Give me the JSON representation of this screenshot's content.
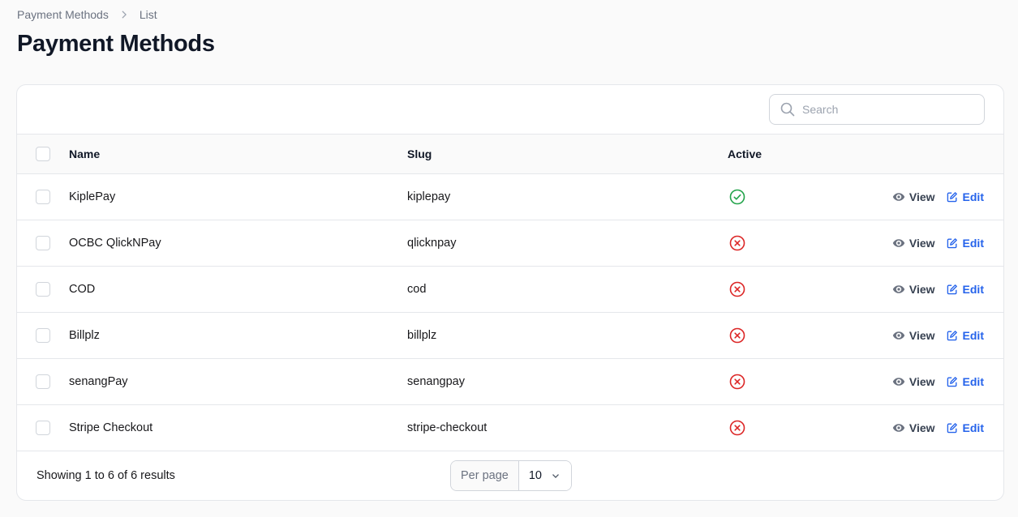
{
  "breadcrumb": {
    "parent": "Payment Methods",
    "current": "List"
  },
  "page": {
    "title": "Payment Methods"
  },
  "search": {
    "placeholder": "Search"
  },
  "table": {
    "headers": {
      "name": "Name",
      "slug": "Slug",
      "active": "Active"
    },
    "rows": [
      {
        "name": "KiplePay",
        "slug": "kiplepay",
        "active": true
      },
      {
        "name": "OCBC QlickNPay",
        "slug": "qlicknpay",
        "active": false
      },
      {
        "name": "COD",
        "slug": "cod",
        "active": false
      },
      {
        "name": "Billplz",
        "slug": "billplz",
        "active": false
      },
      {
        "name": "senangPay",
        "slug": "senangpay",
        "active": false
      },
      {
        "name": "Stripe Checkout",
        "slug": "stripe-checkout",
        "active": false
      }
    ],
    "actions": {
      "view": "View",
      "edit": "Edit"
    }
  },
  "footer": {
    "showing": "Showing 1 to 6 of 6 results",
    "per_page_label": "Per page",
    "per_page_value": "10"
  },
  "colors": {
    "active": "#22a34a",
    "inactive": "#dc2626",
    "edit": "#2563eb"
  },
  "icons": {
    "breadcrumb_separator": "chevron-right-icon",
    "search": "search-icon",
    "active_true": "check-circle-icon",
    "active_false": "x-circle-icon",
    "view": "eye-icon",
    "edit": "pencil-square-icon",
    "select": "chevron-down-icon"
  }
}
